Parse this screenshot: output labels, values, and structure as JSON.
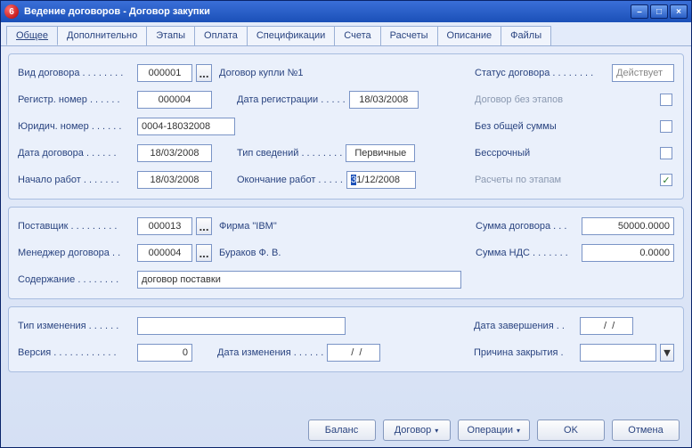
{
  "window": {
    "title": "Ведение договоров - Договор закупки",
    "icon_glyph": "6"
  },
  "tabs": [
    "Общее",
    "Дополнительно",
    "Этапы",
    "Оплата",
    "Спецификации",
    "Счета",
    "Расчеты",
    "Описание",
    "Файлы"
  ],
  "panel1": {
    "left": {
      "contract_type_label": "Вид договора . . . . . . . .",
      "contract_type_value": "000001",
      "contract_type_desc": "Договор купли №1",
      "reg_number_label": "Регистр. номер . . . . . .",
      "reg_number_value": "000004",
      "reg_date_label": "Дата регистрации . . . . .",
      "reg_date_value": "18/03/2008",
      "legal_number_label": "Юридич. номер . . . . . .",
      "legal_number_value": "0004-18032008",
      "contract_date_label": "Дата договора . . . . . .",
      "contract_date_value": "18/03/2008",
      "info_type_label": "Тип сведений . . . . . . . .",
      "info_type_value": "Первичные",
      "work_start_label": "Начало работ . . . . . . .",
      "work_start_value": "18/03/2008",
      "work_end_label": "Окончание работ . . . . .",
      "work_end_value_sel": "3",
      "work_end_value_rest": "1/12/2008"
    },
    "right": {
      "status_label": "Статус договора . . . . . . . .",
      "status_value": "Действует",
      "no_stages_label": "Договор без этапов",
      "no_stages_checked": false,
      "no_total_label": "Без общей суммы",
      "no_total_checked": false,
      "perpetual_label": "Бессрочный",
      "perpetual_checked": false,
      "calc_by_stages_label": "Расчеты по этапам",
      "calc_by_stages_checked": true
    }
  },
  "panel2": {
    "left": {
      "supplier_label": "Поставщик . . . . . . . . .",
      "supplier_value": "000013",
      "supplier_desc": "Фирма \"IBM\"",
      "manager_label": "Менеджер договора . .",
      "manager_value": "000004",
      "manager_desc": "Бураков Ф. В.",
      "content_label": "Содержание . . . . . . . .",
      "content_value": "договор поставки"
    },
    "right": {
      "sum_label": "Сумма договора . . .",
      "sum_value": "50000.0000",
      "vat_label": "Сумма НДС . . . . . . .",
      "vat_value": "0.0000"
    }
  },
  "panel3": {
    "left": {
      "change_type_label": "Тип изменения . . . . . .",
      "change_type_value": "",
      "version_label": "Версия . . . . . . . . . . . .",
      "version_value": "0",
      "change_date_label": "Дата изменения . . . . . .",
      "change_date_value": "  /  /"
    },
    "right": {
      "end_date_label": "Дата завершения . .",
      "end_date_value": "  /  /",
      "close_reason_label": "Причина закрытия .",
      "close_reason_value": ""
    }
  },
  "footer": {
    "balance": "Баланс",
    "contract": "Договор",
    "operations": "Операции",
    "ok": "OK",
    "cancel": "Отмена"
  },
  "glyphs": {
    "ellipsis": "...",
    "check": "✓",
    "caret": "▾",
    "min": "–",
    "max": "□",
    "close": "×"
  }
}
